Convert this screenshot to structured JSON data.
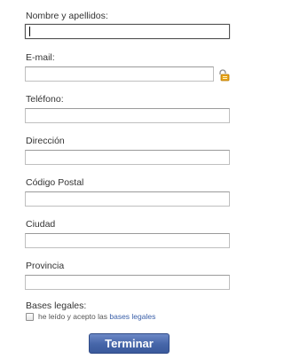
{
  "form": {
    "fields": [
      {
        "label": "Nombre y apellidos:",
        "value": ""
      },
      {
        "label": "E-mail:",
        "value": ""
      },
      {
        "label": "Teléfono:",
        "value": ""
      },
      {
        "label": "Dirección",
        "value": ""
      },
      {
        "label": "Código Postal",
        "value": ""
      },
      {
        "label": "Ciudad",
        "value": ""
      },
      {
        "label": "Provincia",
        "value": ""
      }
    ],
    "legal": {
      "label": "Bases legales:",
      "accept_prefix": "he leído y acepto las",
      "link_text": "bases legales",
      "checked": false
    },
    "submit_label": "Terminar",
    "colors": {
      "button": "#4565a8",
      "link": "#3a5fa8",
      "lock_icon": "#e8a317"
    },
    "icons": {
      "email_field_icon": "lock-icon"
    }
  }
}
